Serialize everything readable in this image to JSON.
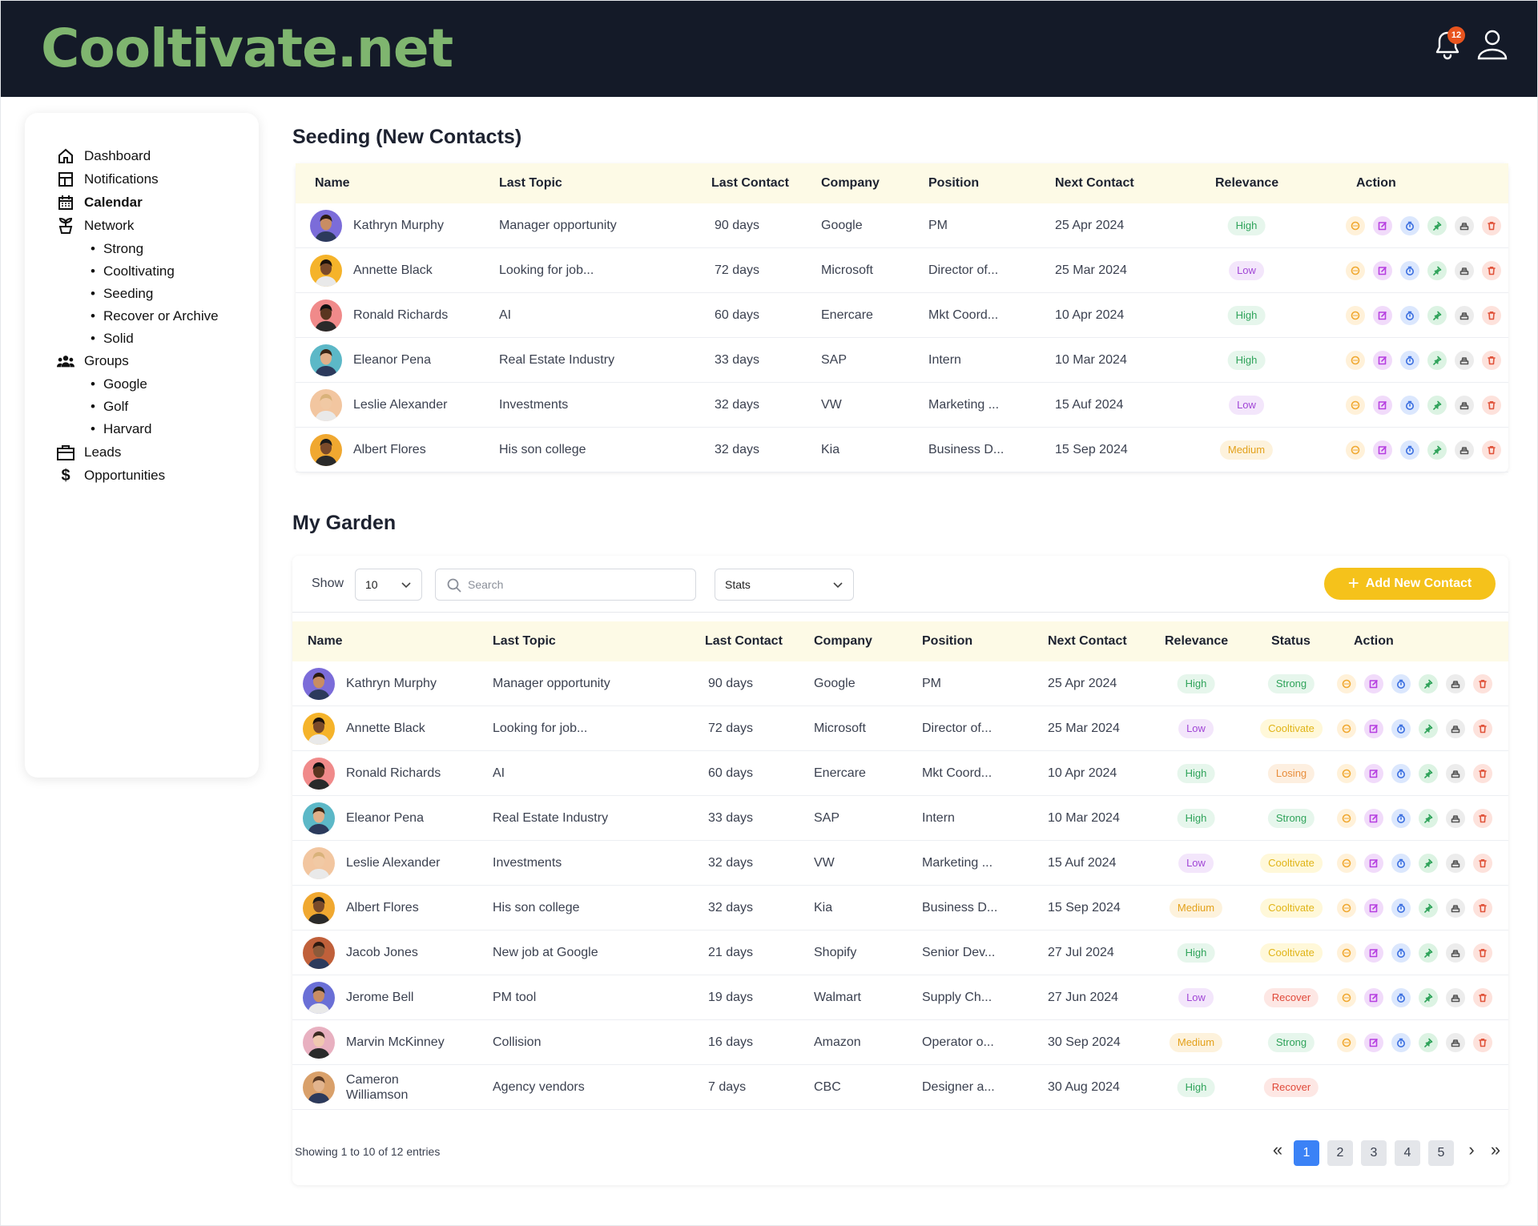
{
  "brand": {
    "logo_text": "Cooltivate.net",
    "logo_color": "#7fb56f"
  },
  "header": {
    "notification_count": "12"
  },
  "sidebar": {
    "items": [
      {
        "label": "Dashboard",
        "icon": "home-icon"
      },
      {
        "label": "Notifications",
        "icon": "layout-icon"
      },
      {
        "label": "Calendar",
        "icon": "calendar-icon"
      },
      {
        "label": "Network",
        "icon": "sprout-icon"
      },
      {
        "label": "Groups",
        "icon": "users-icon"
      },
      {
        "label": "Leads",
        "icon": "briefcase-icon"
      },
      {
        "label": "Opportunities",
        "icon": "dollar-icon"
      }
    ],
    "network_sub": [
      "Strong",
      "Cooltivating",
      "Seeding",
      "Recover or Archive",
      "Solid"
    ],
    "groups_sub": [
      "Google",
      "Golf",
      "Harvard"
    ]
  },
  "seeding": {
    "title": "Seeding (New Contacts)",
    "columns": [
      "Name",
      "Last Topic",
      "Last Contact",
      "Company",
      "Position",
      "Next Contact",
      "Relevance",
      "Action"
    ],
    "rows": [
      {
        "name": "Kathryn Murphy",
        "topic": "Manager opportunity",
        "last": "90 days",
        "company": "Google",
        "position": "PM",
        "next": "25 Apr 2024",
        "relevance": "High"
      },
      {
        "name": "Annette Black",
        "topic": "Looking for job...",
        "last": "72 days",
        "company": "Microsoft",
        "position": "Director of...",
        "next": "25 Mar 2024",
        "relevance": "Low"
      },
      {
        "name": "Ronald Richards",
        "topic": "AI",
        "last": "60 days",
        "company": "Enercare",
        "position": "Mkt Coord...",
        "next": "10 Apr 2024",
        "relevance": "High"
      },
      {
        "name": "Eleanor Pena",
        "topic": "Real Estate Industry",
        "last": "33 days",
        "company": "SAP",
        "position": "Intern",
        "next": "10 Mar 2024",
        "relevance": "High"
      },
      {
        "name": "Leslie Alexander",
        "topic": "Investments",
        "last": "32 days",
        "company": "VW",
        "position": "Marketing ...",
        "next": "15 Auf 2024",
        "relevance": "Low"
      },
      {
        "name": "Albert Flores",
        "topic": "His son college",
        "last": "32 days",
        "company": "Kia",
        "position": "Business D...",
        "next": "15 Sep 2024",
        "relevance": "Medium"
      }
    ]
  },
  "garden": {
    "title": "My Garden",
    "show_label": "Show",
    "show_value": "10",
    "search_placeholder": "Search",
    "stats_value": "Stats",
    "add_button": "Add New Contact",
    "columns": [
      "Name",
      "Last Topic",
      "Last Contact",
      "Company",
      "Position",
      "Next Contact",
      "Relevance",
      "Status",
      "Action"
    ],
    "rows": [
      {
        "name": "Kathryn Murphy",
        "topic": "Manager opportunity",
        "last": "90 days",
        "company": "Google",
        "position": "PM",
        "next": "25 Apr 2024",
        "relevance": "High",
        "status": "Strong"
      },
      {
        "name": "Annette Black",
        "topic": "Looking for job...",
        "last": "72 days",
        "company": "Microsoft",
        "position": "Director of...",
        "next": "25 Mar 2024",
        "relevance": "Low",
        "status": "Cooltivate"
      },
      {
        "name": "Ronald Richards",
        "topic": "AI",
        "last": "60 days",
        "company": "Enercare",
        "position": "Mkt Coord...",
        "next": "10 Apr 2024",
        "relevance": "High",
        "status": "Losing"
      },
      {
        "name": "Eleanor Pena",
        "topic": "Real Estate Industry",
        "last": "33 days",
        "company": "SAP",
        "position": "Intern",
        "next": "10 Mar 2024",
        "relevance": "High",
        "status": "Strong"
      },
      {
        "name": "Leslie Alexander",
        "topic": "Investments",
        "last": "32 days",
        "company": "VW",
        "position": "Marketing ...",
        "next": "15 Auf 2024",
        "relevance": "Low",
        "status": "Cooltivate"
      },
      {
        "name": "Albert Flores",
        "topic": "His son college",
        "last": "32 days",
        "company": "Kia",
        "position": "Business D...",
        "next": "15 Sep 2024",
        "relevance": "Medium",
        "status": "Cooltivate"
      },
      {
        "name": "Jacob Jones",
        "topic": "New job at Google",
        "last": "21 days",
        "company": "Shopify",
        "position": "Senior Dev...",
        "next": "27 Jul 2024",
        "relevance": "High",
        "status": "Cooltivate"
      },
      {
        "name": "Jerome Bell",
        "topic": "PM tool",
        "last": "19 days",
        "company": "Walmart",
        "position": "Supply Ch...",
        "next": "27 Jun 2024",
        "relevance": "Low",
        "status": "Recover"
      },
      {
        "name": "Marvin McKinney",
        "topic": "Collision",
        "last": "16 days",
        "company": "Amazon",
        "position": "Operator o...",
        "next": "30 Sep 2024",
        "relevance": "Medium",
        "status": "Strong"
      },
      {
        "name": "Cameron Williamson",
        "topic": "Agency vendors",
        "last": "7 days",
        "company": "CBC",
        "position": "Designer a...",
        "next": "30 Aug 2024",
        "relevance": "High",
        "status": "Recover"
      }
    ],
    "footer_text": "Showing 1 to 10 of 12 entries",
    "pages": [
      "1",
      "2",
      "3",
      "4",
      "5"
    ],
    "active_page": "1"
  },
  "colors": {
    "topbar": "#141a28",
    "header_row": "#fdfae6",
    "accent_yellow": "#f5c21b",
    "page_active": "#3b82f6"
  }
}
